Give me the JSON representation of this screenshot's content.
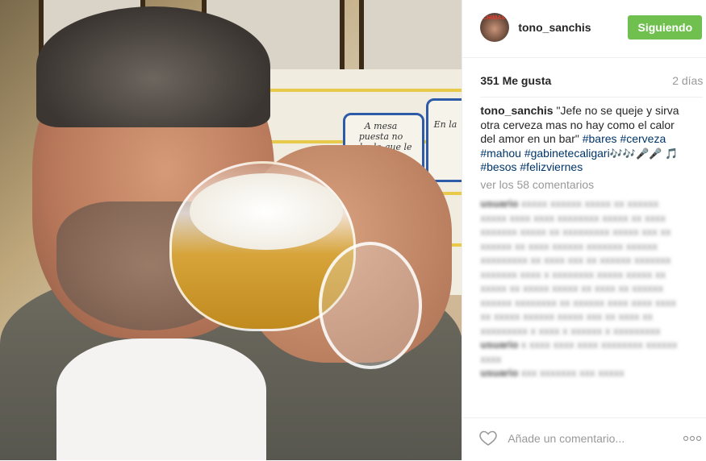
{
  "post": {
    "username": "tono_sanchis",
    "follow_label": "Siguiendo",
    "likes": "351 Me gusta",
    "time_ago": "2 días",
    "caption_user": "tono_sanchis",
    "caption_text": " \"Jefe no se queje y sirva otra cerveza mas no hay como el calor del amor en un bar\" ",
    "hashtags": [
      "#bares",
      "#cerveza",
      "#mahou",
      "#gabinetecaligari",
      "#besos",
      "#felizviernes"
    ],
    "emojis_1": "🎶🎶🎤🎤",
    "emojis_2": "🎵",
    "view_comments": "ver los 58 comentarios",
    "comment_placeholder": "Añade un comentario...",
    "more_label": "ooo"
  },
  "photo_text": {
    "tile_1": "A mesa puesta no sabe lo que le cuesta.",
    "tile_2": "En la"
  },
  "avatar_badge": "CHIMAS",
  "colors": {
    "follow_bg": "#70c050",
    "hashtag": "#003569",
    "muted": "#999999"
  },
  "icons": {
    "heart": "heart-icon",
    "more": "more-options-icon"
  }
}
